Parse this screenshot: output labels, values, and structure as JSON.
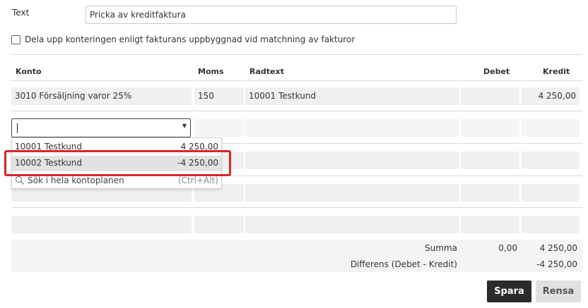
{
  "form": {
    "text_label": "Text",
    "text_value": "Pricka av kreditfaktura",
    "checkbox_label": "Dela upp konteringen enligt fakturans uppbyggnad vid matchning av fakturor"
  },
  "table": {
    "headers": {
      "konto": "Konto",
      "moms": "Moms",
      "radtext": "Radtext",
      "debet": "Debet",
      "kredit": "Kredit"
    },
    "row1": {
      "konto": "3010 Försäljning varor 25%",
      "moms": "150",
      "radtext": "10001 Testkund",
      "debet": "",
      "kredit": "4 250,00"
    }
  },
  "dropdown": {
    "items": [
      {
        "name": "10001 Testkund",
        "amount": "4 250,00"
      },
      {
        "name": "10002 Testkund",
        "amount": "-4 250,00"
      }
    ],
    "search_label": "Sök i hela kontoplanen",
    "search_hint": "(Ctrl+Alt)"
  },
  "summary": {
    "summa_label": "Summa",
    "summa_debet": "0,00",
    "summa_kredit": "4 250,00",
    "diff_label": "Differens (Debet - Kredit)",
    "diff_value": "-4 250,00"
  },
  "buttons": {
    "save": "Spara",
    "clear": "Rensa"
  },
  "colors": {
    "highlight": "#d8252a",
    "primary_button": "#2b2b2b"
  }
}
